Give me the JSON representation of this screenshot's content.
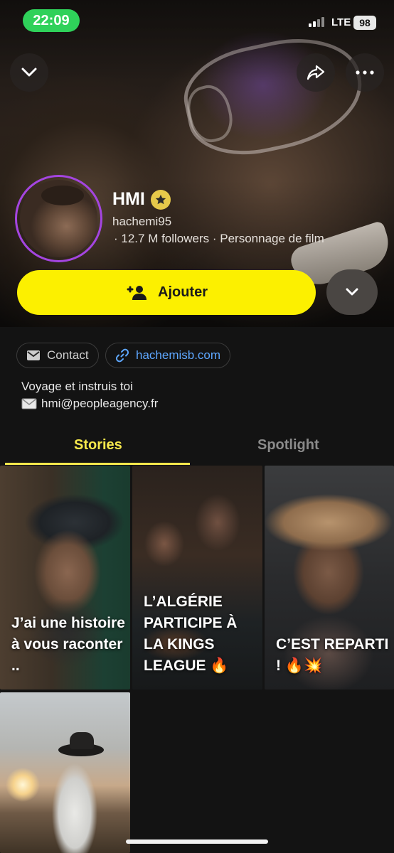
{
  "status_bar": {
    "time": "22:09",
    "network": "LTE",
    "battery": "98"
  },
  "profile": {
    "name": "HMI",
    "handle": "hachemi95",
    "meta": "· 12.7 M followers · Personnage de film",
    "add_label": "Ajouter"
  },
  "info": {
    "contact_label": "Contact",
    "link_label": "hachemisb.com",
    "bio_line1": "Voyage et instruis toi",
    "bio_line2": "hmi@peopleagency.fr"
  },
  "tabs": [
    {
      "label": "Stories",
      "active": true
    },
    {
      "label": "Spotlight",
      "active": false
    }
  ],
  "stories": [
    {
      "caption": "J’ai une histoire à vous raconter .."
    },
    {
      "caption": "L’ALGÉRIE PARTICIPE À LA KINGS LEAGUE 🔥"
    },
    {
      "caption": "C’EST REPARTI ! 🔥💥"
    },
    {
      "caption": ""
    }
  ],
  "colors": {
    "accent_yellow": "#fcf000",
    "tab_active": "#f6e84c",
    "link": "#5ea7ff",
    "ring": "#a445e0",
    "time_pill": "#2fd15a"
  },
  "icons": [
    "chevron-down-icon",
    "share-icon",
    "more-icon",
    "star-badge-icon",
    "add-friend-icon",
    "mail-icon",
    "link-icon",
    "envelope-icon"
  ]
}
